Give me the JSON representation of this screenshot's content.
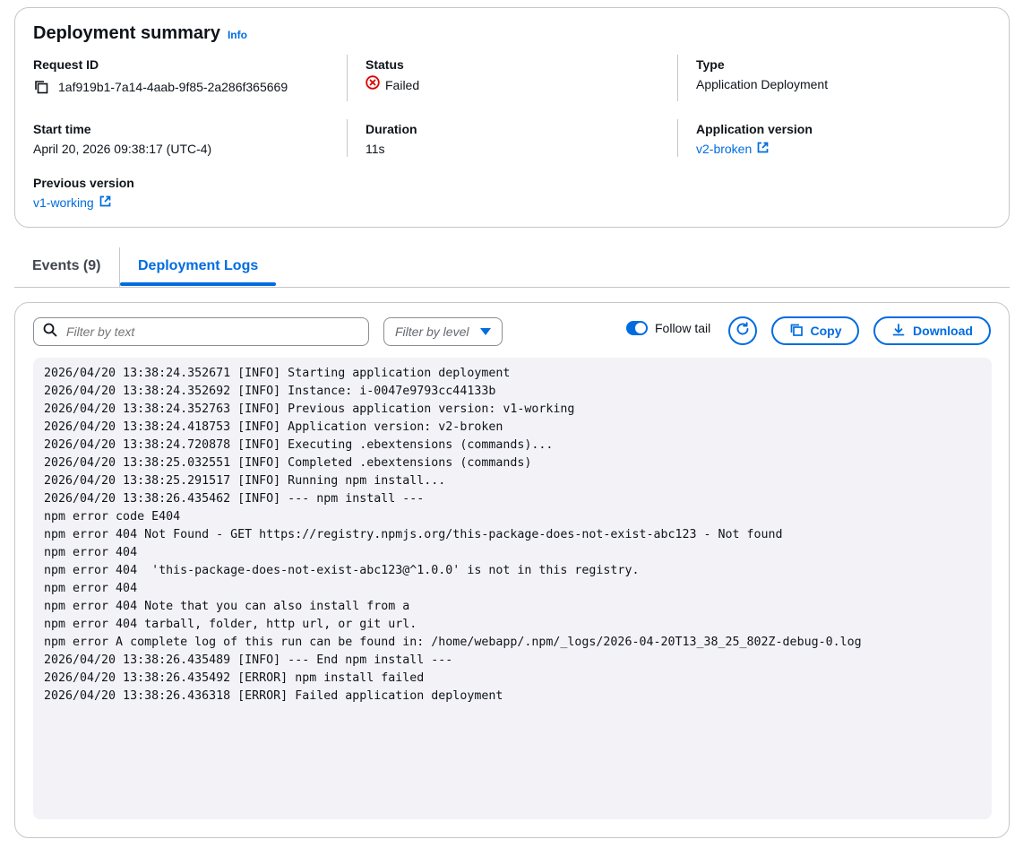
{
  "summary": {
    "title": "Deployment summary",
    "info": "Info",
    "request_id_label": "Request ID",
    "request_id": "1af919b1-7a14-4aab-9f85-2a286f365669",
    "status_label": "Status",
    "status": "Failed",
    "type_label": "Type",
    "type": "Application Deployment",
    "start_time_label": "Start time",
    "start_time": "April 20, 2026 09:38:17 (UTC-4)",
    "duration_label": "Duration",
    "duration": "11s",
    "app_version_label": "Application version",
    "app_version": "v2-broken",
    "prev_version_label": "Previous version",
    "prev_version": "v1-working"
  },
  "tabs": [
    {
      "label": "Events (9)"
    },
    {
      "label": "Deployment Logs"
    }
  ],
  "toolbar": {
    "filter_text_placeholder": "Filter by text",
    "filter_level_label": "Filter by level",
    "follow_tail_label": "Follow tail",
    "follow_tail_on": true,
    "copy_label": "Copy",
    "download_label": "Download"
  },
  "logs": [
    "2026/04/20 13:38:24.352671 [INFO] Starting application deployment",
    "2026/04/20 13:38:24.352692 [INFO] Instance: i-0047e9793cc44133b",
    "2026/04/20 13:38:24.352763 [INFO] Previous application version: v1-working",
    "2026/04/20 13:38:24.418753 [INFO] Application version: v2-broken",
    "2026/04/20 13:38:24.720878 [INFO] Executing .ebextensions (commands)...",
    "2026/04/20 13:38:25.032551 [INFO] Completed .ebextensions (commands)",
    "2026/04/20 13:38:25.291517 [INFO] Running npm install...",
    "2026/04/20 13:38:26.435462 [INFO] --- npm install ---",
    "npm error code E404",
    "npm error 404 Not Found - GET https://registry.npmjs.org/this-package-does-not-exist-abc123 - Not found",
    "npm error 404",
    "npm error 404  'this-package-does-not-exist-abc123@^1.0.0' is not in this registry.",
    "npm error 404",
    "npm error 404 Note that you can also install from a",
    "npm error 404 tarball, folder, http url, or git url.",
    "npm error A complete log of this run can be found in: /home/webapp/.npm/_logs/2026-04-20T13_38_25_802Z-debug-0.log",
    "2026/04/20 13:38:26.435489 [INFO] --- End npm install ---",
    "2026/04/20 13:38:26.435492 [ERROR] npm install failed",
    "2026/04/20 13:38:26.436318 [ERROR] Failed application deployment"
  ]
}
